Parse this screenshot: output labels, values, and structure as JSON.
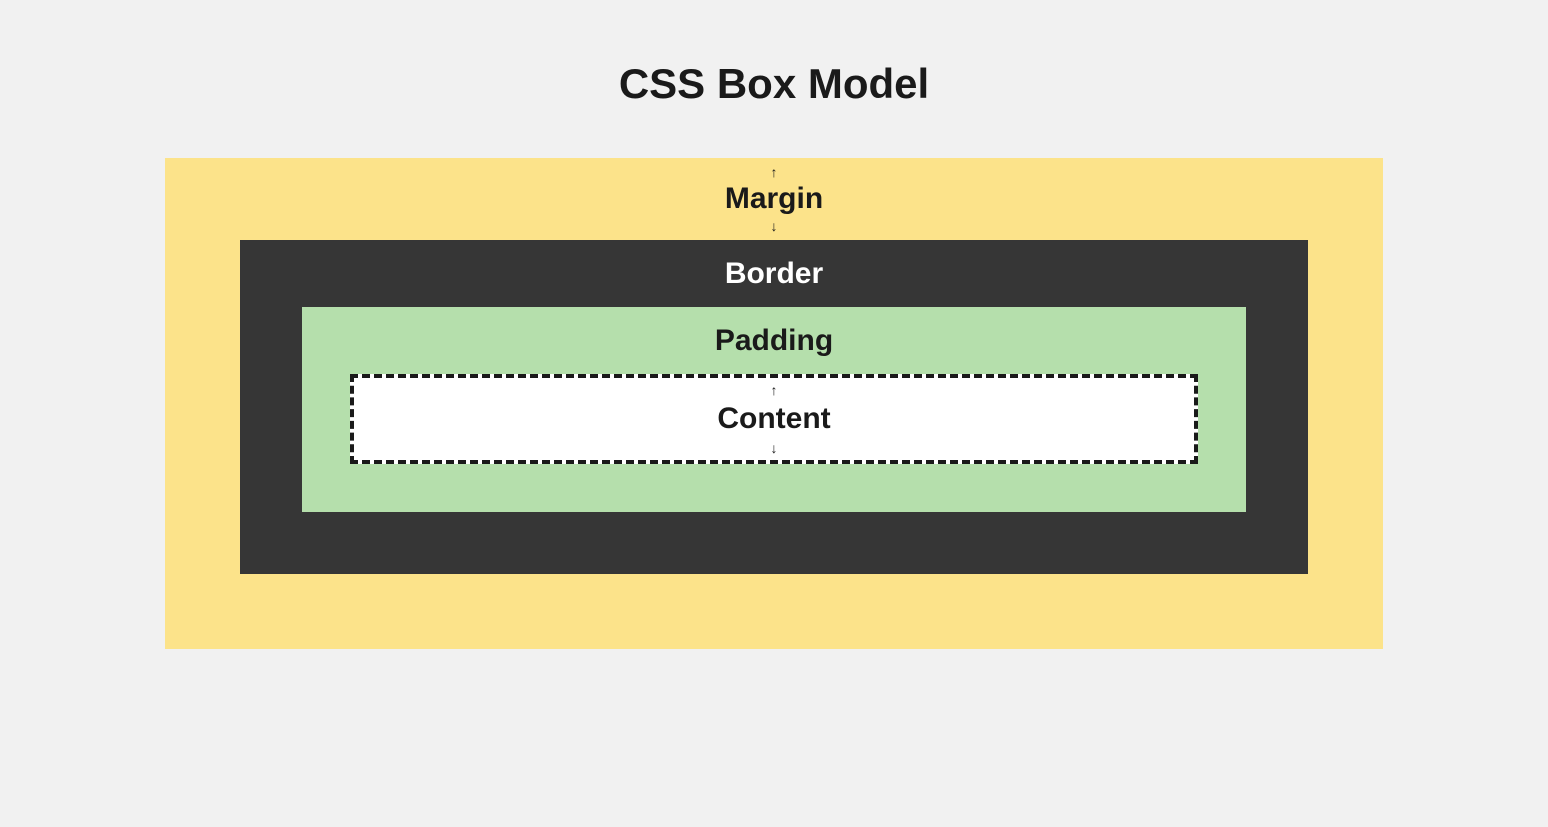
{
  "title": "CSS Box Model",
  "layers": {
    "margin": {
      "label": "Margin",
      "color": "#fce38a"
    },
    "border": {
      "label": "Border",
      "color": "#363636"
    },
    "padding": {
      "label": "Padding",
      "color": "#b5dfac"
    },
    "content": {
      "label": "Content",
      "color": "#ffffff"
    }
  }
}
